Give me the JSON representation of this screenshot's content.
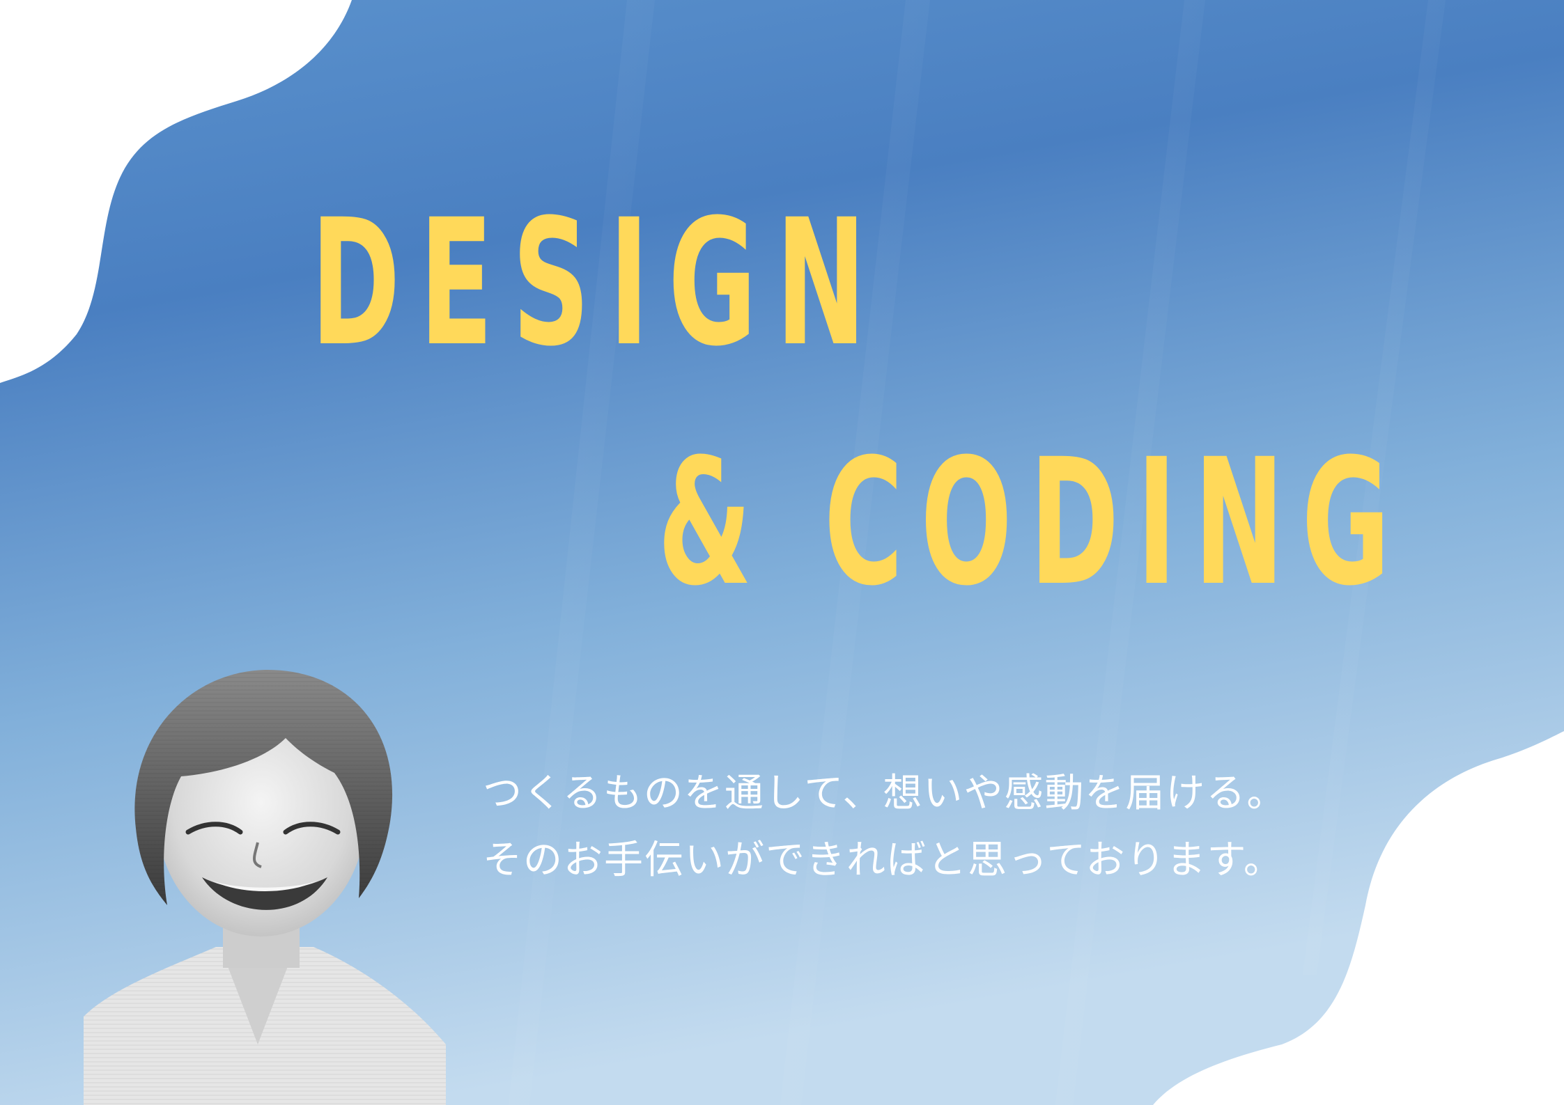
{
  "headline": {
    "line1": "DESIGN",
    "line2": "& CODING"
  },
  "message": {
    "line1": "つくるものを通して、想いや感動を届ける。",
    "line2": "そのお手伝いができればと思っております。"
  },
  "colors": {
    "headline": "#ffd95a",
    "background_top": "#4a7fc1",
    "background_bottom": "#b7d3ea",
    "message": "#ffffff"
  },
  "portrait": {
    "icon": "person-photo"
  }
}
